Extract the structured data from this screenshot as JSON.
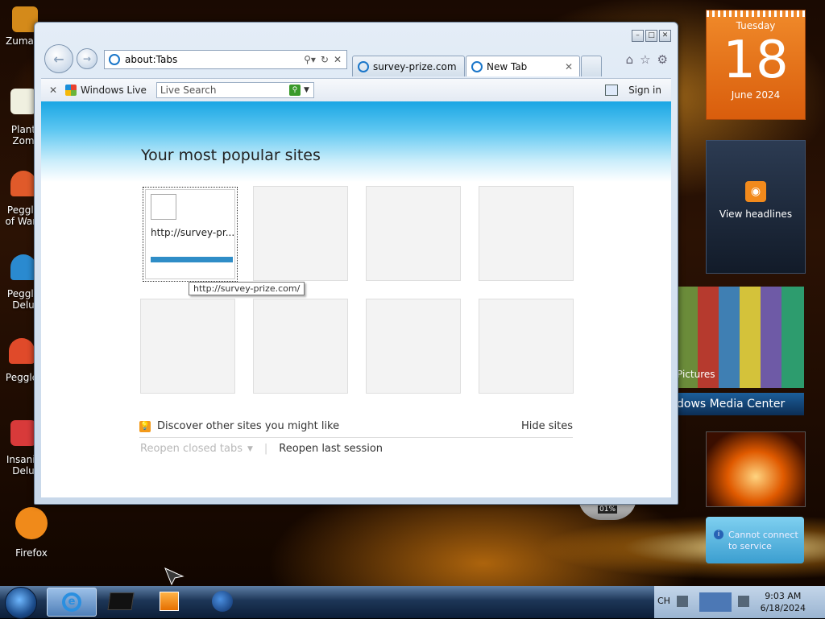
{
  "desktop": {
    "icons": [
      {
        "label": "Zuma D",
        "color": "#d48a1a"
      },
      {
        "label": "Plant Zom",
        "color": "#f0f0e0"
      },
      {
        "label": "Peggle of Warc",
        "color": "#e05a2a"
      },
      {
        "label": "Peggle Delu",
        "color": "#2a8ad0"
      },
      {
        "label": "Peggle",
        "color": "#e04a2a"
      },
      {
        "label": "Insanic Delu",
        "color": "#d83a3a"
      },
      {
        "label": "Firefox",
        "color": "#f08a1a"
      }
    ]
  },
  "browser": {
    "address": {
      "value": "about:Tabs"
    },
    "tabs": [
      {
        "label": "survey-prize.com",
        "close": ""
      },
      {
        "label": "New Tab",
        "close": "✕"
      }
    ],
    "command_bar": {
      "close_glyph": "✕",
      "brand": "Windows Live",
      "search_placeholder": "Live Search",
      "sign_in": "Sign in"
    },
    "content": {
      "heading": "Your most popular sites",
      "tiles": [
        {
          "label": "http://survey-pr...",
          "filled": true
        },
        {
          "label": "",
          "filled": false
        },
        {
          "label": "",
          "filled": false
        },
        {
          "label": "",
          "filled": false
        },
        {
          "label": "",
          "filled": false
        },
        {
          "label": "",
          "filled": false
        },
        {
          "label": "",
          "filled": false
        },
        {
          "label": "",
          "filled": false
        }
      ],
      "tooltip": "http://survey-prize.com/",
      "discover": "Discover other sites you might like",
      "hide_sites": "Hide sites",
      "reopen_closed": "Reopen closed tabs",
      "reopen_last": "Reopen last session"
    }
  },
  "gadgets": {
    "calendar": {
      "weekday": "Tuesday",
      "day": "18",
      "month": "June 2024"
    },
    "feed": {
      "label": "View headlines"
    },
    "pictures": {
      "label": "Pictures"
    },
    "media_center": {
      "label": "dows Media Center"
    },
    "meter": {
      "value": "01%"
    },
    "weather": {
      "line1": "Cannot connect",
      "line2": "to service"
    }
  },
  "taskbar": {
    "lang": "CH",
    "time": "9:03 AM",
    "date": "6/18/2024"
  },
  "colors": {
    "accent": "#1aa6e4",
    "calendar": "#e06a14",
    "tile_bar": "#2f8dc7"
  }
}
